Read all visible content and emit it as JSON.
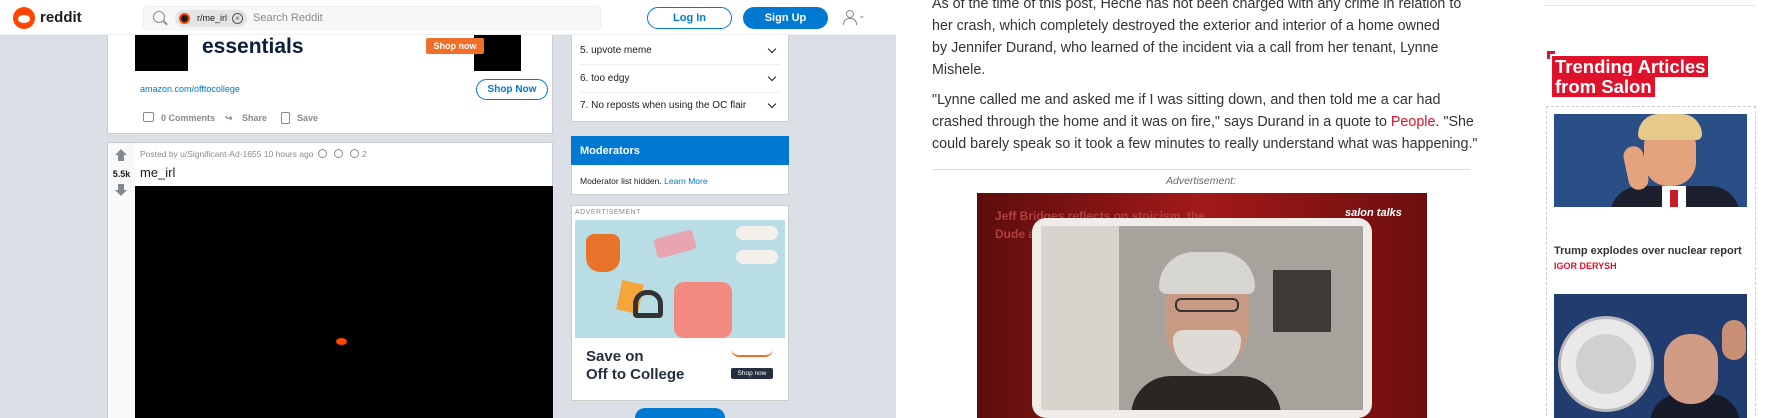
{
  "reddit": {
    "header": {
      "logo_text": "reddit",
      "community_chip": "r/me_irl",
      "search_placeholder": "Search Reddit",
      "login_label": "Log In",
      "signup_label": "Sign Up"
    },
    "ad_post": {
      "banner_headline": "essentials",
      "banner_button": "Shop now",
      "domain": "amazon.com/offtocollege",
      "shop_now_label": "Shop Now",
      "comments_label": "0 Comments",
      "share_label": "Share",
      "save_label": "Save"
    },
    "post": {
      "score": "5.5k",
      "meta": "Posted by u/Significant-Ad-1655 10 hours ago",
      "award_count": "2",
      "title": "me_irl"
    },
    "rules": [
      {
        "label": "5. upvote meme"
      },
      {
        "label": "6. too edgy"
      },
      {
        "label": "7. No reposts when using the OC flair"
      }
    ],
    "moderators": {
      "heading": "Moderators",
      "text": "Moderator list hidden.",
      "link": "Learn More"
    },
    "side_ad": {
      "label": "ADVERTISEMENT",
      "headline_line1": "Save on",
      "headline_line2": "Off to College",
      "button": "Shop now"
    }
  },
  "salon": {
    "paragraph1": {
      "line1": "As of the time of this post, Heche has not been charged with any crime in relation to",
      "line2": "her crash, which completely destroyed the exterior and interior of a home owned",
      "line3": "by Jennifer Durand, who learned of the incident via a call from her tenant, Lynne",
      "line4": "Mishele."
    },
    "paragraph2": {
      "line1": "\"Lynne called me and asked me if I was sitting down, and then told me a car had",
      "line2": "crashed through the home and it was on fire,\" says Durand in a quote to ",
      "link": "People",
      "line2_after": ". \"She",
      "line3": "could barely speak so it took a few minutes to really understand what was happening.\""
    },
    "advertisement_label": "Advertisement:",
    "video": {
      "title": "Jeff Bridges reflects on stoicism, the Dude and dealing with his mortality",
      "brand": "salon talks"
    },
    "trending": {
      "title_line1": "Trending Articles",
      "title_line2": "from Salon",
      "articles": [
        {
          "title": "Trump explodes over nuclear report",
          "author": "IGOR DERYSH"
        }
      ]
    },
    "colors": {
      "accent": "#e0112b",
      "reddit_blue": "#0079d3",
      "reddit_orange": "#ff4500"
    }
  }
}
